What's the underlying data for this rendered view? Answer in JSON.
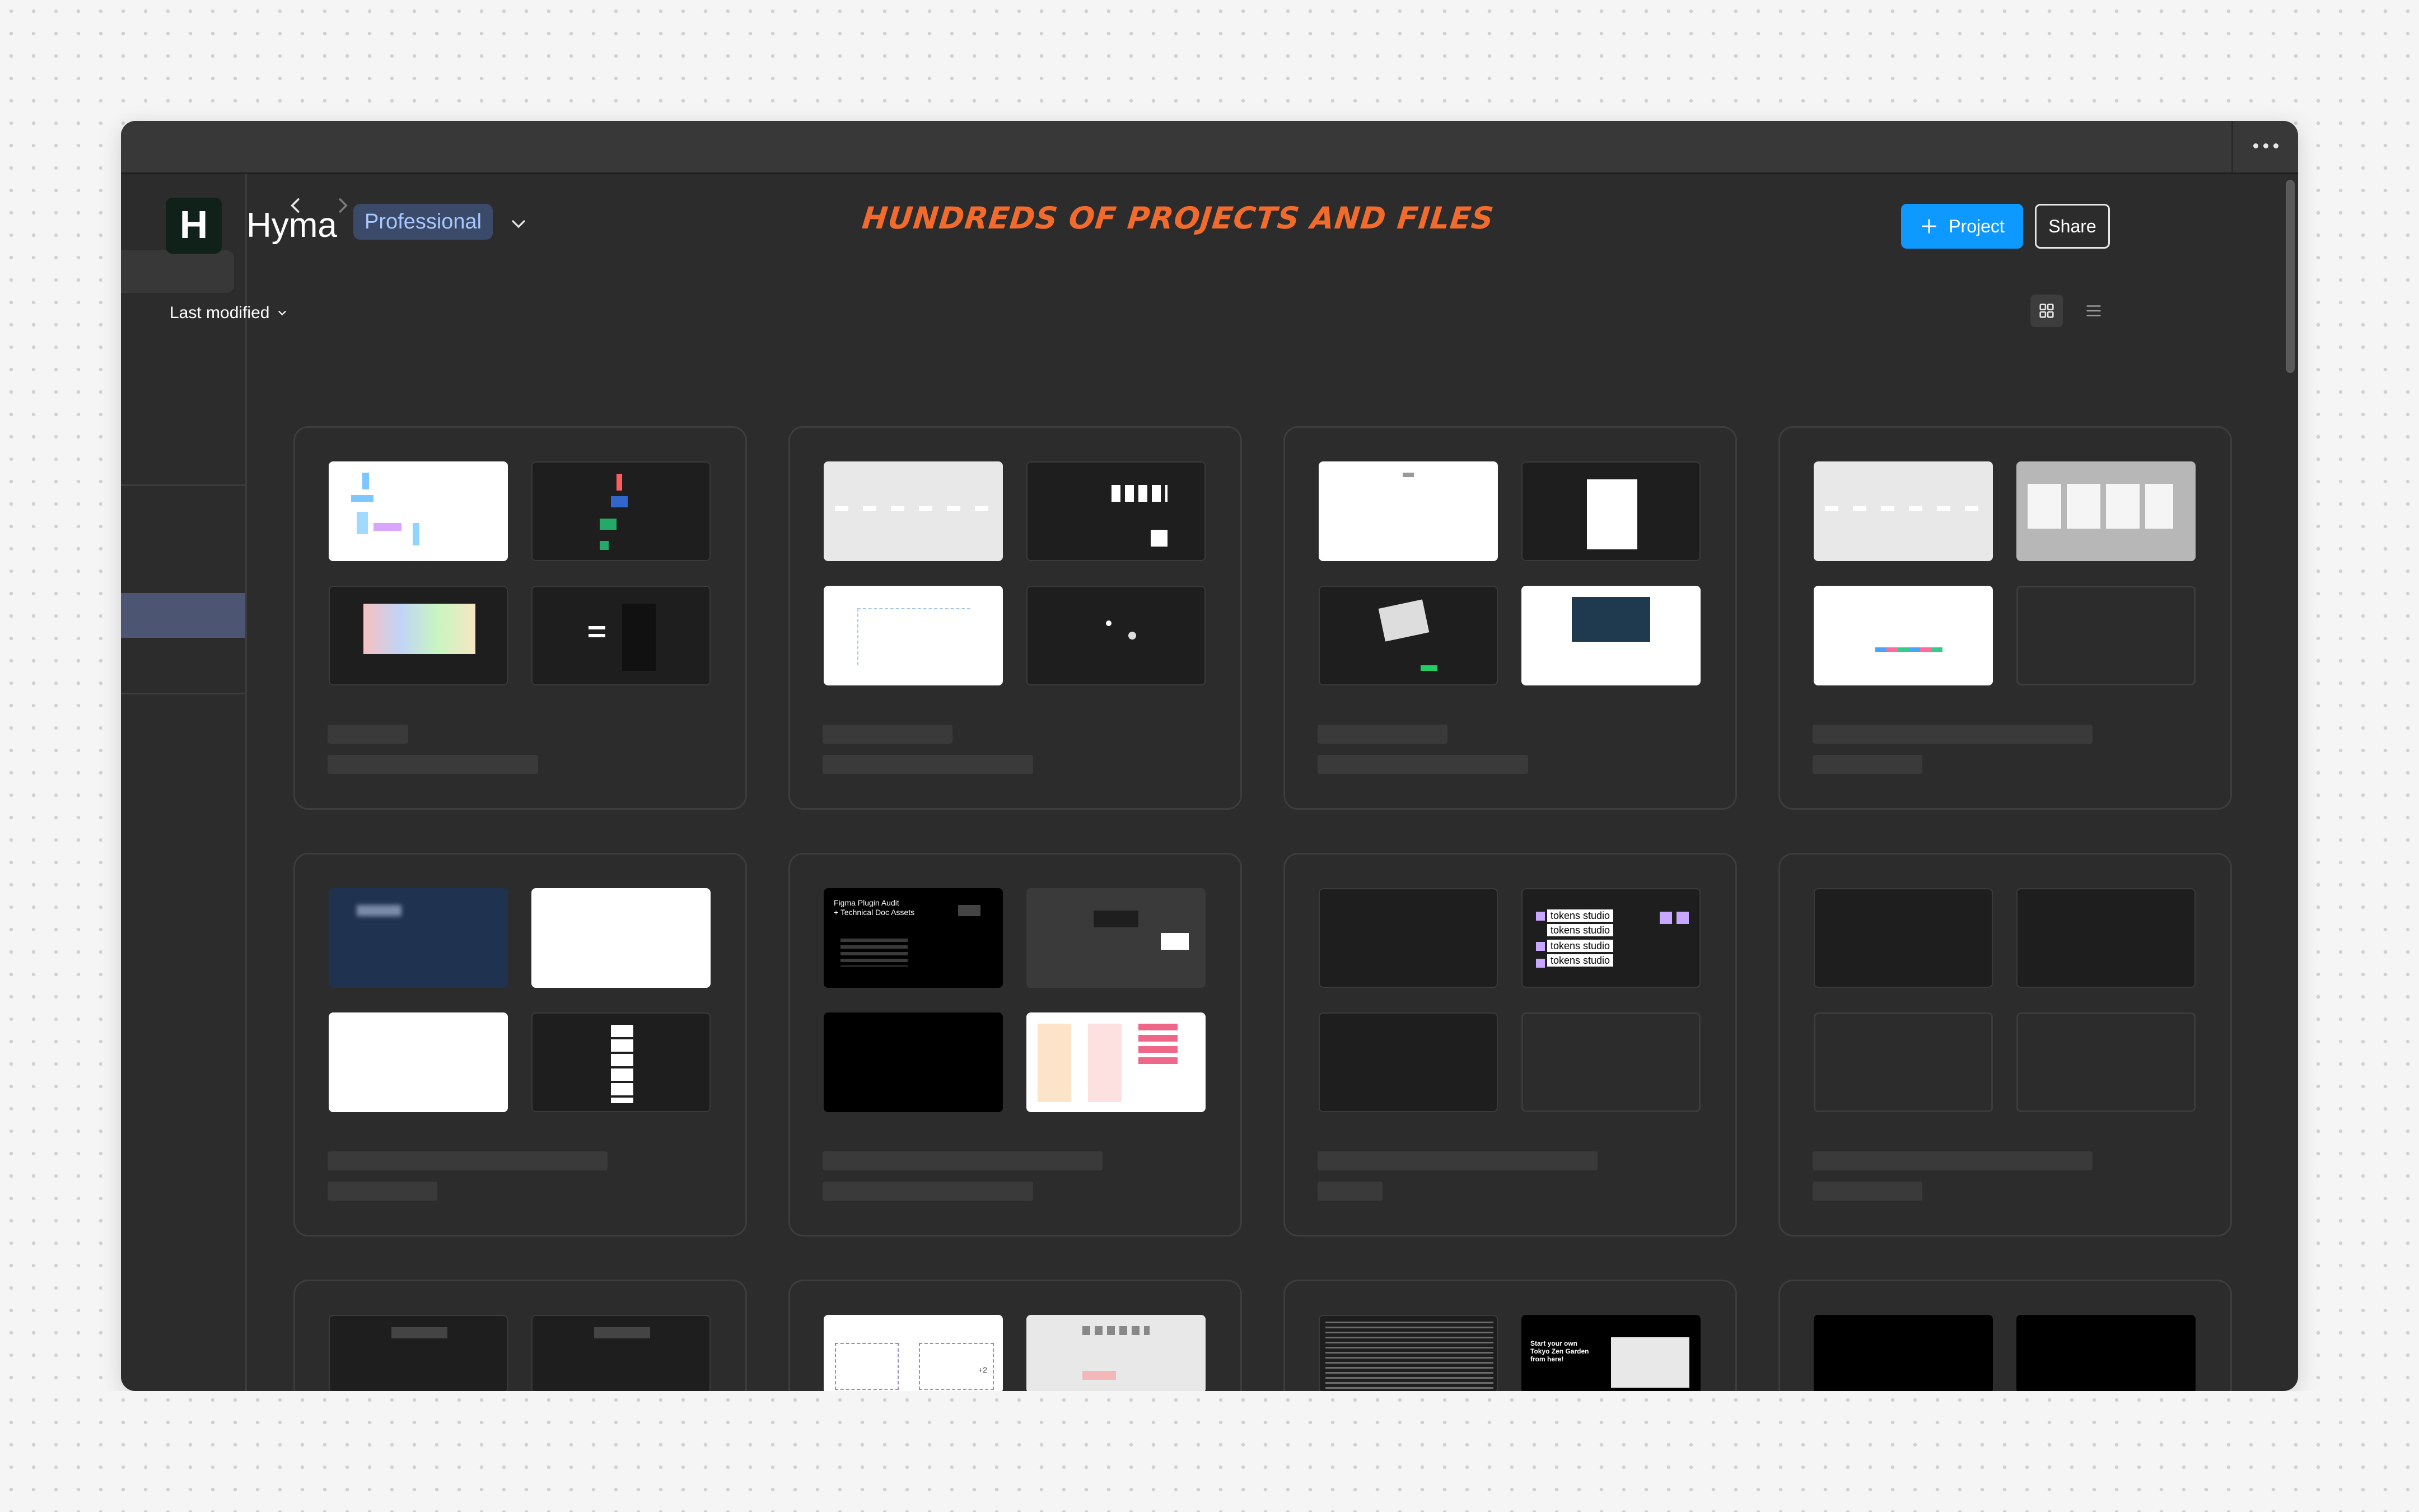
{
  "window": {
    "menu_icon": "more-horizontal-icon"
  },
  "sidebar": {
    "notification_icon": "bell-icon"
  },
  "navigation": {
    "back_icon": "chevron-left-icon",
    "forward_icon": "chevron-right-icon"
  },
  "team": {
    "logo_letter": "H",
    "name": "Hyma",
    "plan": "Professional",
    "switcher_icon": "chevron-down-icon"
  },
  "actions": {
    "new_project_label": "Project",
    "share_label": "Share"
  },
  "annotation": {
    "text": "HUNDREDS OF PROJECTS AND FILES",
    "color": "#f36b2c"
  },
  "toolbar": {
    "sort_label": "Last modified",
    "grid_view_icon": "grid-view-icon",
    "list_view_icon": "list-view-icon"
  },
  "colors": {
    "accent": "#0d99ff",
    "background": "#2c2c2c",
    "badge_bg": "#3a4a68",
    "badge_text": "#a8c6ff"
  },
  "thumbnails": {
    "plugin_doc_title": "Figma Plugin Audit\n+ Technical Doc Assets",
    "tokens_label": "tokens studio",
    "garden_title": "Start your own\nTokyo Zen Garden\nfrom here!",
    "avatar_overflow": "+2"
  }
}
